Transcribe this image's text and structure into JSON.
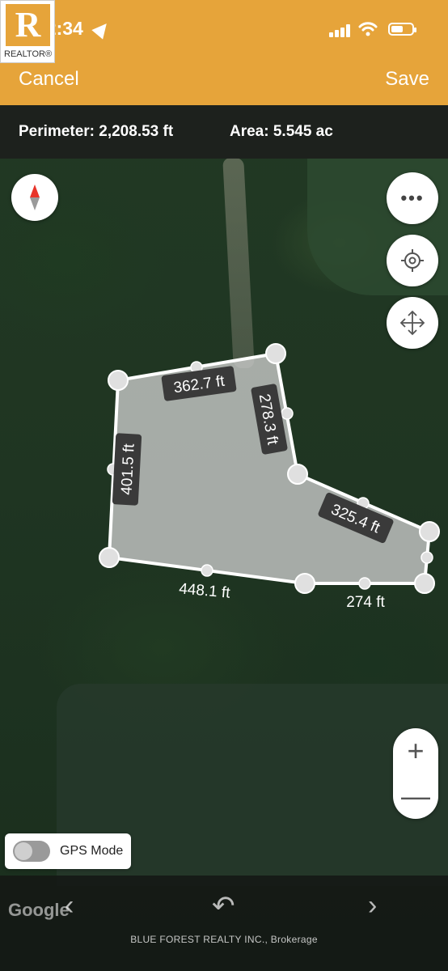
{
  "status_bar": {
    "time": "12:34"
  },
  "brand": {
    "logo_letter": "R",
    "logo_text": "REALTOR®"
  },
  "header": {
    "cancel_label": "Cancel",
    "save_label": "Save"
  },
  "measure": {
    "perimeter": "Perimeter: 2,208.53 ft",
    "area": "Area: 5.545 ac"
  },
  "edges": [
    "362.7 ft",
    "278.3 ft",
    "325.4 ft",
    "274 ft",
    "448.1 ft",
    "401.5 ft"
  ],
  "controls": {
    "more_icon": "more-icon",
    "locate_icon": "crosshair-icon",
    "move_icon": "move-arrows-icon",
    "compass_icon": "compass-icon"
  },
  "zoom": {
    "plus": "+",
    "minus": "—"
  },
  "gps": {
    "label": "GPS Mode",
    "enabled": false
  },
  "bottom": {
    "google": "Google",
    "prev": "‹",
    "undo": "↶",
    "next": "›",
    "brokerage": "BLUE FOREST REALTY INC., Brokerage"
  },
  "colors": {
    "accent": "#e6a43a",
    "polygon_fill": "#c8c8c8",
    "label_bg": "#3a3a3a"
  }
}
